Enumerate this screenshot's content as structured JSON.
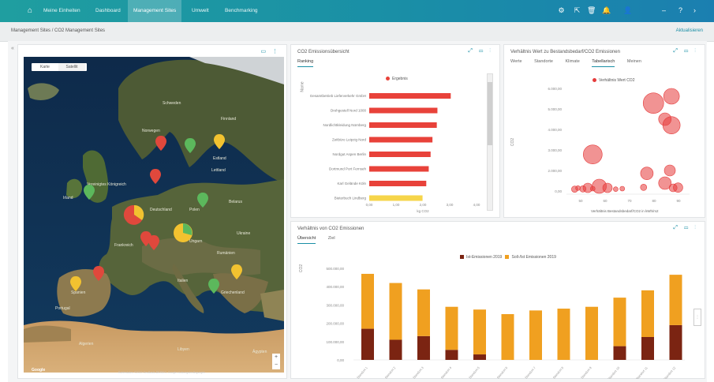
{
  "nav": {
    "items": [
      "Meine Einheiten",
      "Dashboard",
      "Management Sites",
      "Umwelt",
      "Benchmarking"
    ],
    "active_index": 2
  },
  "breadcrumb": {
    "path": "Management Sites  /  CO2 Management Sites",
    "right_link": "Aktualisieren"
  },
  "panels": {
    "map": {
      "toggle": [
        "Karte",
        "Satellit"
      ],
      "attribution": "Kartendaten ©2019 GeoBasis-DE/BKG, Google  Nutzungsbedingungen"
    },
    "bars": {
      "title": "CO2 Emissionsübersicht",
      "tab": "Ranking",
      "legend": "Ergebnis",
      "ylabel": "Name",
      "xlabel": "kg CO2"
    },
    "scatter": {
      "title": "Verhältnis Wert zu Bestandsbedarf/CO2 Emissionen",
      "tabs": [
        "Werte",
        "Standorte",
        "Klimate",
        "Tabellarisch",
        "Meinen"
      ],
      "selected_tab": 3,
      "legend": "Verhältnis Wert CO2",
      "ylabel": "CO2",
      "xlabel": "Verhältnis Bestandsbedarf/CO2 in kWh/m2"
    },
    "stacked": {
      "title": "Verhältnis von CO2 Emissionen",
      "tabs": [
        "Übersicht",
        "Ziel"
      ],
      "selected_tab": 0,
      "legend": [
        "Ist-Emissionen 2019",
        "Soll-/Ist Emissionen 2019"
      ],
      "ylabel": "CO2",
      "xlabel": "Name"
    }
  },
  "colors": {
    "accent": "#1a8fa6",
    "bar_red": "#e8423a",
    "bar_yellow": "#f6d54a",
    "scatter_red": "#e53b3b",
    "stack_dark": "#7b2412",
    "stack_orange": "#f0a020",
    "marker_red": "#e0483c",
    "marker_green": "#5cb85c",
    "marker_yellow": "#f2c230"
  },
  "chart_data": [
    {
      "type": "bar",
      "title": "CO2 Emissionsübersicht",
      "categories": [
        "Gesamtbetrieb Lieferverkehr GmbH",
        "Drehgestell Nord 1000",
        "Nordlichtkleidung Nürnberg",
        "Zeitbüro Leipzig Nord",
        "Nordgut Aspen Berlin",
        "Dortmund Port Fernseh",
        "Karl Gelände Köln",
        "Bieterbuch Lindberg"
      ],
      "values": [
        2630,
        2200,
        2180,
        2040,
        1980,
        1920,
        1840,
        1720
      ],
      "highlight_index": 7,
      "xlim": [
        0,
        3000
      ],
      "xticks": [
        "0,00",
        "1,00",
        "2,00",
        "3,00",
        "4,00"
      ],
      "ylabel": "Name",
      "xlabel": "kg CO2"
    },
    {
      "type": "scatter",
      "title": "Verhältnis Wert zu Bestandsbedarf/CO2 Emissionen",
      "points": [
        {
          "x": 70,
          "y": 2100,
          "r": 9
        },
        {
          "x": 75,
          "y": 2040,
          "r": 6
        },
        {
          "x": 66,
          "y": 3310,
          "r": 12
        },
        {
          "x": 103,
          "y": 5260,
          "r": 13
        },
        {
          "x": 114,
          "y": 5520,
          "r": 10
        },
        {
          "x": 110,
          "y": 2220,
          "r": 8
        },
        {
          "x": 99,
          "y": 2590,
          "r": 8
        },
        {
          "x": 113,
          "y": 2700,
          "r": 7
        },
        {
          "x": 114,
          "y": 4420,
          "r": 11
        },
        {
          "x": 110,
          "y": 4650,
          "r": 8
        },
        {
          "x": 63,
          "y": 2040,
          "r": 6
        },
        {
          "x": 60,
          "y": 2000,
          "r": 4
        },
        {
          "x": 55,
          "y": 1990,
          "r": 4
        },
        {
          "x": 57,
          "y": 2030,
          "r": 3
        },
        {
          "x": 66,
          "y": 2010,
          "r": 3
        },
        {
          "x": 80,
          "y": 1990,
          "r": 3
        },
        {
          "x": 84,
          "y": 2010,
          "r": 3
        },
        {
          "x": 97,
          "y": 2060,
          "r": 4
        },
        {
          "x": 115,
          "y": 2040,
          "r": 5
        },
        {
          "x": 118,
          "y": 2050,
          "r": 6
        }
      ],
      "yticks": [
        "6.000,00",
        "5.000,00",
        "4.000,00",
        "3.000,00",
        "2.000,00",
        "0,00"
      ],
      "xticks": [
        "50",
        "60",
        "70",
        "80",
        "90"
      ],
      "legend": "Verhältnis Wert CO2",
      "ylabel": "CO2",
      "xlabel": "Verhältnis Bestandsbedarf/CO2 in kWh/m2"
    },
    {
      "type": "bar",
      "title": "Verhältnis von CO2 Emissionen",
      "categories": [
        "Standort 1",
        "Standort 2",
        "Standort 3",
        "Standort 4",
        "Standort 5",
        "Standort 6",
        "Standort 7",
        "Standort 8",
        "Standort 9",
        "Standort 10",
        "Standort 11",
        "Standort 12"
      ],
      "series": [
        {
          "name": "Ist-Emissionen 2019",
          "values": [
            170,
            110,
            130,
            55,
            30,
            0,
            0,
            0,
            0,
            75,
            125,
            190
          ]
        },
        {
          "name": "Soll-/Ist Emissionen 2019",
          "values": [
            300,
            310,
            255,
            235,
            245,
            250,
            270,
            280,
            290,
            265,
            255,
            275
          ]
        }
      ],
      "yticks": [
        "500.000,00",
        "400.000,00",
        "300.000,00",
        "200.000,00",
        "100.000,00",
        "0,00"
      ],
      "ylim": [
        0,
        500
      ],
      "ylabel": "CO2",
      "xlabel": "Name"
    }
  ]
}
